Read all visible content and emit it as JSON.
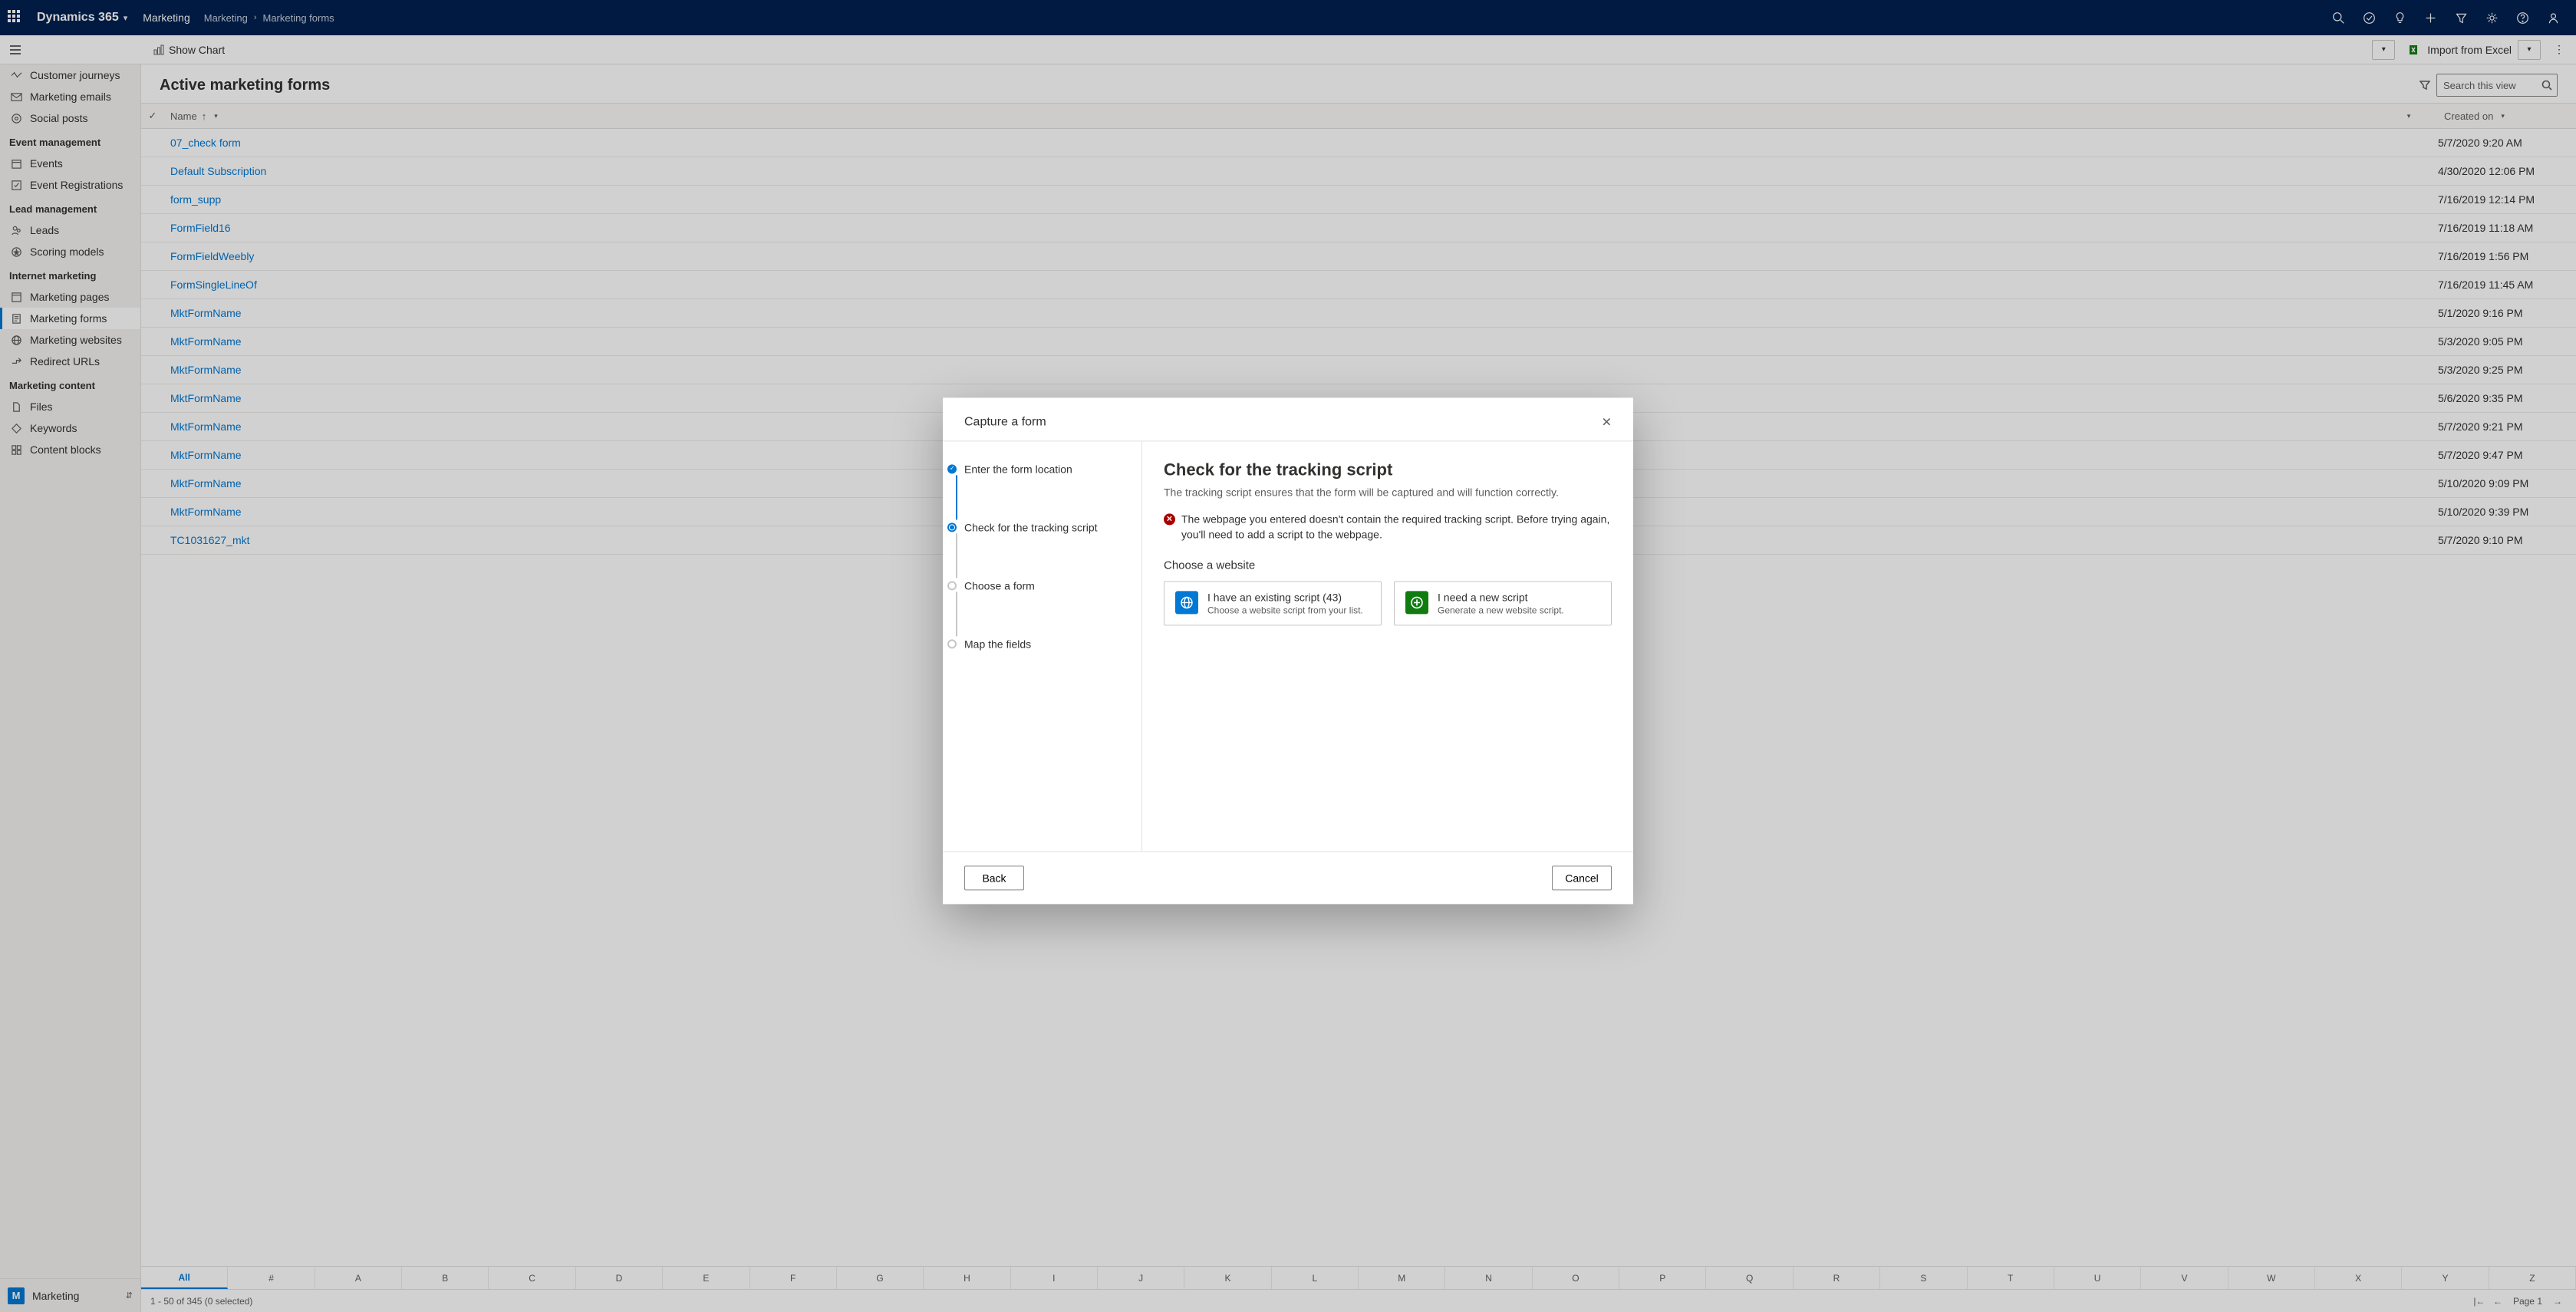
{
  "topbar": {
    "brand": "Dynamics 365",
    "area": "Marketing",
    "crumb1": "Marketing",
    "crumb2": "Marketing forms"
  },
  "cmdrow": {
    "show_chart": "Show Chart",
    "import": "Import from Excel"
  },
  "sidebar": {
    "items": [
      {
        "label": "Customer journeys"
      },
      {
        "label": "Marketing emails"
      },
      {
        "label": "Social posts"
      }
    ],
    "group_event": "Event management",
    "event_items": [
      {
        "label": "Events"
      },
      {
        "label": "Event Registrations"
      }
    ],
    "group_lead": "Lead management",
    "lead_items": [
      {
        "label": "Leads"
      },
      {
        "label": "Scoring models"
      }
    ],
    "group_internet": "Internet marketing",
    "internet_items": [
      {
        "label": "Marketing pages"
      },
      {
        "label": "Marketing forms"
      },
      {
        "label": "Marketing websites"
      },
      {
        "label": "Redirect URLs"
      }
    ],
    "group_content": "Marketing content",
    "content_items": [
      {
        "label": "Files"
      },
      {
        "label": "Keywords"
      },
      {
        "label": "Content blocks"
      }
    ],
    "area_letter": "M",
    "area_label": "Marketing"
  },
  "view": {
    "title": "Active marketing forms",
    "search_placeholder": "Search this view",
    "col_name": "Name",
    "col_created": "Created on"
  },
  "rows": [
    {
      "name": "07_check form",
      "date": "5/7/2020 9:20 AM"
    },
    {
      "name": "Default Subscription",
      "date": "4/30/2020 12:06 PM"
    },
    {
      "name": "form_supp",
      "date": "7/16/2019 12:14 PM"
    },
    {
      "name": "FormField16",
      "date": "7/16/2019 11:18 AM"
    },
    {
      "name": "FormFieldWeebly",
      "date": "7/16/2019 1:56 PM"
    },
    {
      "name": "FormSingleLineOf",
      "date": "7/16/2019 11:45 AM"
    },
    {
      "name": "MktFormName",
      "date": "5/1/2020 9:16 PM"
    },
    {
      "name": "MktFormName",
      "date": "5/3/2020 9:05 PM"
    },
    {
      "name": "MktFormName",
      "date": "5/3/2020 9:25 PM"
    },
    {
      "name": "MktFormName",
      "date": "5/6/2020 9:35 PM"
    },
    {
      "name": "MktFormName",
      "date": "5/7/2020 9:21 PM"
    },
    {
      "name": "MktFormName",
      "date": "5/7/2020 9:47 PM"
    },
    {
      "name": "MktFormName",
      "date": "5/10/2020 9:09 PM"
    },
    {
      "name": "MktFormName",
      "date": "5/10/2020 9:39 PM"
    },
    {
      "name": "TC1031627_mkt",
      "date": "5/7/2020 9:10 PM"
    }
  ],
  "alphabet": [
    "All",
    "#",
    "A",
    "B",
    "C",
    "D",
    "E",
    "F",
    "G",
    "H",
    "I",
    "J",
    "K",
    "L",
    "M",
    "N",
    "O",
    "P",
    "Q",
    "R",
    "S",
    "T",
    "U",
    "V",
    "W",
    "X",
    "Y",
    "Z"
  ],
  "status": {
    "range": "1 - 50 of 345 (0 selected)",
    "page": "Page 1"
  },
  "modal": {
    "title": "Capture a form",
    "steps": [
      {
        "label": "Enter the form location",
        "state": "done"
      },
      {
        "label": "Check for the tracking script",
        "state": "active"
      },
      {
        "label": "Choose a form",
        "state": "pending"
      },
      {
        "label": "Map the fields",
        "state": "pending"
      }
    ],
    "heading": "Check for the tracking script",
    "subtitle": "The tracking script ensures that the form will be captured and will function correctly.",
    "error": "The webpage you entered doesn't contain the required tracking script. Before trying again, you'll need to add a script to the webpage.",
    "choose_label": "Choose a website",
    "card1_title": "I have an existing script (43)",
    "card1_sub": "Choose a website script from your list.",
    "card2_title": "I need a new script",
    "card2_sub": "Generate a new website script.",
    "back": "Back",
    "cancel": "Cancel"
  }
}
